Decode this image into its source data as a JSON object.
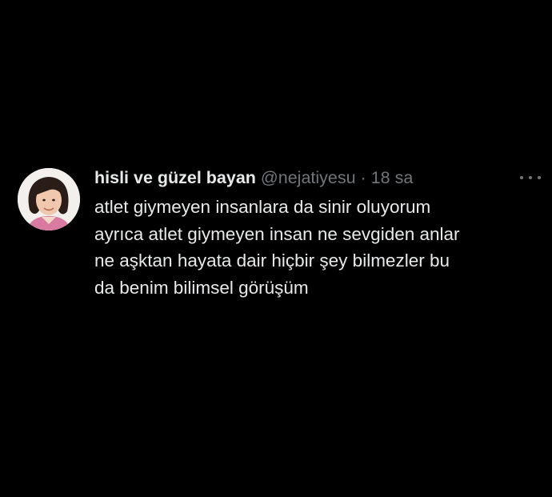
{
  "tweet": {
    "display_name": "hisli ve güzel bayan",
    "handle": "@nejatiyesu",
    "separator": "·",
    "time": "18 sa",
    "lines": [
      "atlet giymeyen insanlara da sinir oluyorum",
      "ayrıca atlet giymeyen insan ne sevgiden anlar",
      "ne aşktan hayata dair hiçbir şey bilmezler bu",
      "da benim bilimsel görüşüm"
    ],
    "more_icon": "more-horizontal-icon"
  },
  "colors": {
    "background": "#000000",
    "primary_text": "#e7e9ea",
    "secondary_text": "#71767b"
  }
}
